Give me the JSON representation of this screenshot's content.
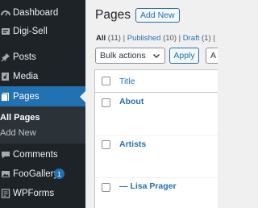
{
  "sidebar": {
    "items": [
      {
        "label": "Dashboard",
        "icon": "dashboard-icon"
      },
      {
        "label": "Digi-Sell",
        "icon": "digi-sell-icon"
      },
      {
        "label": "Posts",
        "icon": "pushpin-icon"
      },
      {
        "label": "Media",
        "icon": "media-icon"
      },
      {
        "label": "Pages",
        "icon": "pages-icon"
      },
      {
        "label": "Comments",
        "icon": "comment-icon"
      },
      {
        "label": "FooGallery",
        "icon": "gallery-icon",
        "badge": "1"
      },
      {
        "label": "WPForms",
        "icon": "wpforms-icon"
      }
    ],
    "submenu": [
      {
        "label": "All Pages"
      },
      {
        "label": "Add New"
      }
    ]
  },
  "header": {
    "title": "Pages",
    "add_new_label": "Add New"
  },
  "views": {
    "all_label": "All",
    "all_count": "(11)",
    "published_label": "Published",
    "published_count": "(10)",
    "draft_label": "Draft",
    "draft_count": "(1)",
    "separator": "|"
  },
  "toolbar": {
    "bulk_actions_value": "Bulk actions",
    "apply_label": "Apply",
    "next_select_value": "A"
  },
  "table": {
    "title_column": "Title",
    "rows": [
      {
        "title": "About"
      },
      {
        "title": "Artists"
      },
      {
        "title": "— Lisa Prager"
      }
    ]
  },
  "colors": {
    "sidebar_bg": "#1d2327",
    "accent": "#2271b1",
    "page_bg": "#f0f0f1"
  }
}
